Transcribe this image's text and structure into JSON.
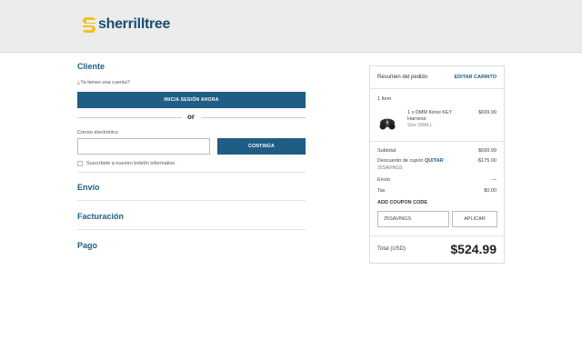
{
  "brand": {
    "name": "sherrilltree",
    "accent": "#1f5d85",
    "logo_color": "#f2c21b"
  },
  "checkout": {
    "customer": {
      "title": "Cliente",
      "have_account": "¿Ya tienes una cuenta?",
      "login_button": "INICIA SESIÓN AHORA",
      "or": "or",
      "email_label": "Correo electrónico",
      "email_value": "",
      "continue_button": "CONTINÚA",
      "newsletter_label": "Suscríbete a nuestro boletín informativo."
    },
    "shipping": {
      "title": "Envío"
    },
    "billing": {
      "title": "Facturación"
    },
    "payment": {
      "title": "Pago"
    }
  },
  "summary": {
    "title": "Resumen del pedido",
    "edit_cart": "EDITAR CARRITO",
    "item_count": "1 Item",
    "item": {
      "name_line1": "1 x DMM Kinisi KEY",
      "name_line2": "Harness",
      "size": "Size SMALL",
      "price": "$699.99",
      "icon": "harness-image"
    },
    "subtotal_label": "Subtotal",
    "subtotal_value": "$699.99",
    "discount_label": "Descuento de cupón",
    "discount_remove": "QUITAR",
    "discount_code": "25SAVINGS",
    "discount_value": "-$175.00",
    "shipping_label": "Envío",
    "shipping_value": "—",
    "tax_label": "Tax",
    "tax_value": "$0.00",
    "coupon_heading": "ADD COUPON CODE",
    "coupon_value": "25SAVINGS",
    "apply_button": "APLICAR",
    "total_label": "Total (USD)",
    "total_value": "$524.99"
  }
}
